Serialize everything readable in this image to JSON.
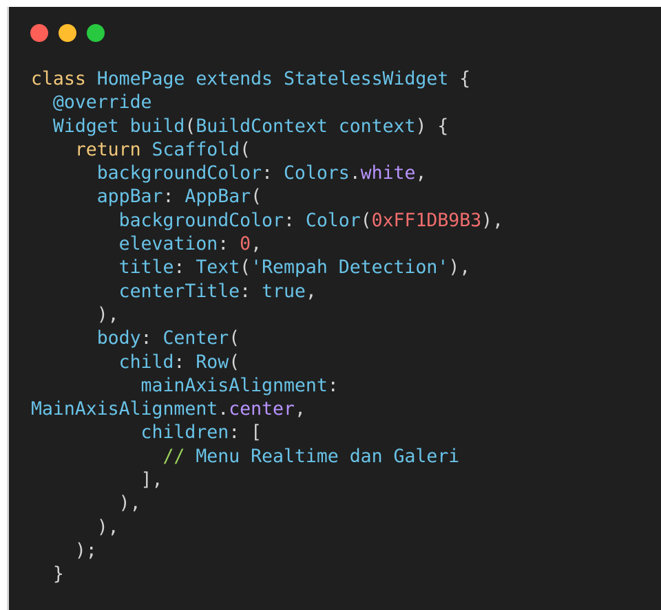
{
  "window": {
    "buttons": [
      "close",
      "minimize",
      "maximize"
    ],
    "colors": {
      "red": "#ff5f57",
      "yellow": "#ffbd2e",
      "green": "#28c840"
    }
  },
  "colors": {
    "background": "#1f1f1f",
    "keyword": "#f2c879",
    "identifier": "#69c3e8",
    "member": "#b894ff",
    "number": "#f26d6d",
    "comment": "#9ad15a",
    "punctuation": "#d4d4d4"
  },
  "code_lines": [
    [
      {
        "t": "class ",
        "c": "kw"
      },
      {
        "t": "HomePage ",
        "c": "id"
      },
      {
        "t": "extends ",
        "c": "id"
      },
      {
        "t": "StatelessWidget ",
        "c": "id"
      },
      {
        "t": "{",
        "c": "p"
      }
    ],
    [
      {
        "t": "  @override",
        "c": "id"
      }
    ],
    [
      {
        "t": "  Widget ",
        "c": "id"
      },
      {
        "t": "build",
        "c": "id"
      },
      {
        "t": "(",
        "c": "p"
      },
      {
        "t": "BuildContext ",
        "c": "id"
      },
      {
        "t": "context",
        "c": "id"
      },
      {
        "t": ") {",
        "c": "p"
      }
    ],
    [
      {
        "t": "    return ",
        "c": "kw"
      },
      {
        "t": "Scaffold",
        "c": "id"
      },
      {
        "t": "(",
        "c": "p"
      }
    ],
    [
      {
        "t": "      backgroundColor",
        "c": "id"
      },
      {
        "t": ": ",
        "c": "p"
      },
      {
        "t": "Colors",
        "c": "id"
      },
      {
        "t": ".",
        "c": "p"
      },
      {
        "t": "white",
        "c": "mem"
      },
      {
        "t": ",",
        "c": "p"
      }
    ],
    [
      {
        "t": "      appBar",
        "c": "id"
      },
      {
        "t": ": ",
        "c": "p"
      },
      {
        "t": "AppBar",
        "c": "id"
      },
      {
        "t": "(",
        "c": "p"
      }
    ],
    [
      {
        "t": "        backgroundColor",
        "c": "id"
      },
      {
        "t": ": ",
        "c": "p"
      },
      {
        "t": "Color",
        "c": "id"
      },
      {
        "t": "(",
        "c": "p"
      },
      {
        "t": "0xFF1DB9B3",
        "c": "num"
      },
      {
        "t": "),",
        "c": "p"
      }
    ],
    [
      {
        "t": "        elevation",
        "c": "id"
      },
      {
        "t": ": ",
        "c": "p"
      },
      {
        "t": "0",
        "c": "num"
      },
      {
        "t": ",",
        "c": "p"
      }
    ],
    [
      {
        "t": "        title",
        "c": "id"
      },
      {
        "t": ": ",
        "c": "p"
      },
      {
        "t": "Text",
        "c": "id"
      },
      {
        "t": "(",
        "c": "p"
      },
      {
        "t": "'Rempah Detection'",
        "c": "str"
      },
      {
        "t": "),",
        "c": "p"
      }
    ],
    [
      {
        "t": "        centerTitle",
        "c": "id"
      },
      {
        "t": ": ",
        "c": "p"
      },
      {
        "t": "true",
        "c": "id"
      },
      {
        "t": ",",
        "c": "p"
      }
    ],
    [
      {
        "t": "      ),",
        "c": "p"
      }
    ],
    [
      {
        "t": "      body",
        "c": "id"
      },
      {
        "t": ": ",
        "c": "p"
      },
      {
        "t": "Center",
        "c": "id"
      },
      {
        "t": "(",
        "c": "p"
      }
    ],
    [
      {
        "t": "        child",
        "c": "id"
      },
      {
        "t": ": ",
        "c": "p"
      },
      {
        "t": "Row",
        "c": "id"
      },
      {
        "t": "(",
        "c": "p"
      }
    ],
    [
      {
        "t": "          mainAxisAlignment",
        "c": "id"
      },
      {
        "t": ":",
        "c": "p"
      }
    ],
    [
      {
        "t": "MainAxisAlignment",
        "c": "id"
      },
      {
        "t": ".",
        "c": "p"
      },
      {
        "t": "center",
        "c": "mem"
      },
      {
        "t": ",",
        "c": "p"
      }
    ],
    [
      {
        "t": "          children",
        "c": "id"
      },
      {
        "t": ": [",
        "c": "p"
      }
    ],
    [
      {
        "t": "            // ",
        "c": "cm"
      },
      {
        "t": "Menu Realtime dan Galeri",
        "c": "id"
      }
    ],
    [
      {
        "t": "          ],",
        "c": "p"
      }
    ],
    [
      {
        "t": "        ),",
        "c": "p"
      }
    ],
    [
      {
        "t": "      ),",
        "c": "p"
      }
    ],
    [
      {
        "t": "    );",
        "c": "p"
      }
    ],
    [
      {
        "t": "  }",
        "c": "p"
      }
    ]
  ]
}
